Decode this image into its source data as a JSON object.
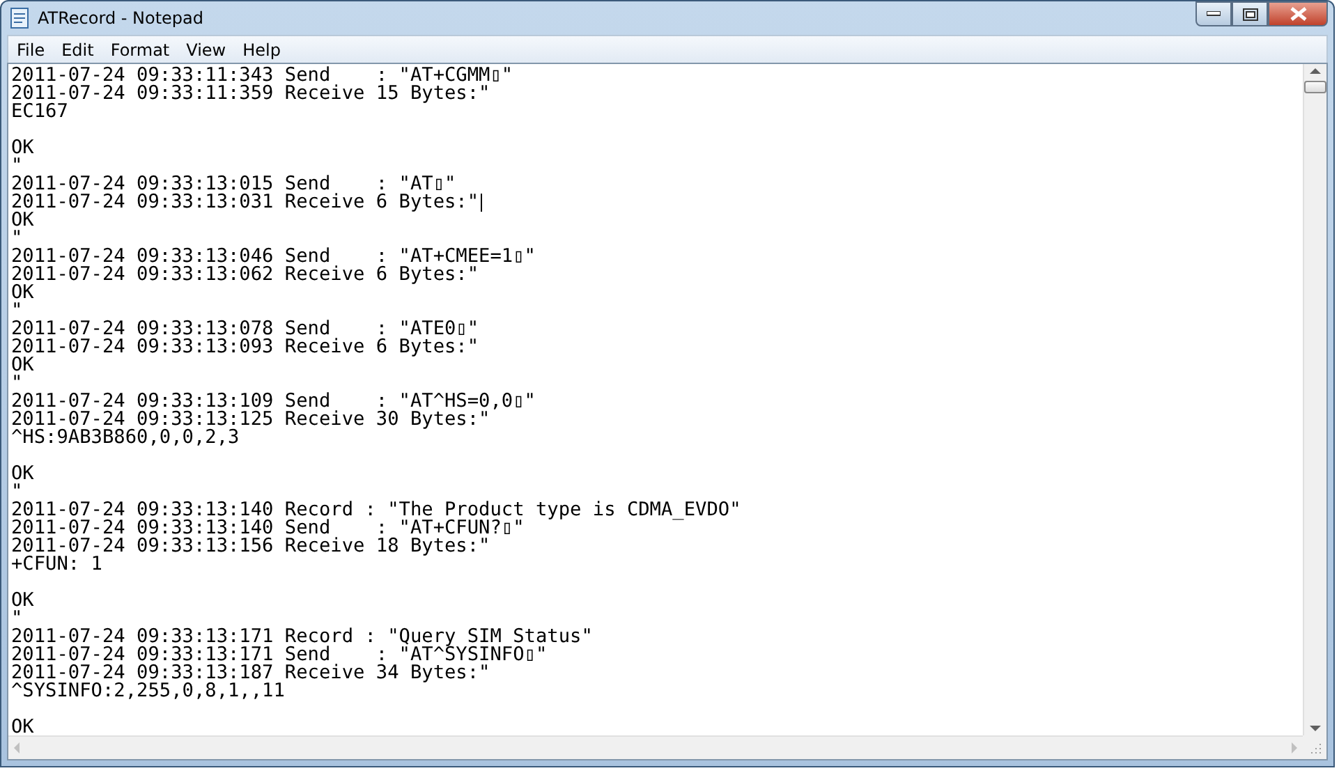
{
  "window": {
    "title": "ATRecord - Notepad"
  },
  "menu": [
    "File",
    "Edit",
    "Format",
    "View",
    "Help"
  ],
  "editor": {
    "paragraphs": [
      {
        "lines": [
          {
            "text": "2011-07-24 09:33:11:343 Send    : \"AT+CGMM▯\"",
            "caret": false
          },
          {
            "text": "2011-07-24 09:33:11:359 Receive 15 Bytes:\"",
            "caret": false
          },
          {
            "text": "EC167",
            "caret": false
          }
        ]
      },
      {
        "lines": [
          {
            "text": "OK",
            "caret": false
          },
          {
            "text": "\"",
            "caret": false
          },
          {
            "text": "2011-07-24 09:33:13:015 Send    : \"AT▯\"",
            "caret": false
          },
          {
            "text": "2011-07-24 09:33:13:031 Receive 6 Bytes:\"",
            "caret": true
          },
          {
            "text": "OK",
            "caret": false
          },
          {
            "text": "\"",
            "caret": false
          },
          {
            "text": "2011-07-24 09:33:13:046 Send    : \"AT+CMEE=1▯\"",
            "caret": false
          },
          {
            "text": "2011-07-24 09:33:13:062 Receive 6 Bytes:\"",
            "caret": false
          },
          {
            "text": "OK",
            "caret": false
          },
          {
            "text": "\"",
            "caret": false
          },
          {
            "text": "2011-07-24 09:33:13:078 Send    : \"ATE0▯\"",
            "caret": false
          },
          {
            "text": "2011-07-24 09:33:13:093 Receive 6 Bytes:\"",
            "caret": false
          },
          {
            "text": "OK",
            "caret": false
          },
          {
            "text": "\"",
            "caret": false
          },
          {
            "text": "2011-07-24 09:33:13:109 Send    : \"AT^HS=0,0▯\"",
            "caret": false
          },
          {
            "text": "2011-07-24 09:33:13:125 Receive 30 Bytes:\"",
            "caret": false
          },
          {
            "text": "^HS:9AB3B860,0,0,2,3",
            "caret": false
          }
        ]
      },
      {
        "lines": [
          {
            "text": "OK",
            "caret": false
          },
          {
            "text": "\"",
            "caret": false
          },
          {
            "text": "2011-07-24 09:33:13:140 Record : \"The Product type is CDMA_EVDO\"",
            "caret": false
          },
          {
            "text": "2011-07-24 09:33:13:140 Send    : \"AT+CFUN?▯\"",
            "caret": false
          },
          {
            "text": "2011-07-24 09:33:13:156 Receive 18 Bytes:\"",
            "caret": false
          },
          {
            "text": "+CFUN: 1",
            "caret": false
          }
        ]
      },
      {
        "lines": [
          {
            "text": "OK",
            "caret": false
          },
          {
            "text": "\"",
            "caret": false
          },
          {
            "text": "2011-07-24 09:33:13:171 Record : \"Query SIM Status\"",
            "caret": false
          },
          {
            "text": "2011-07-24 09:33:13:171 Send    : \"AT^SYSINFO▯\"",
            "caret": false
          },
          {
            "text": "2011-07-24 09:33:13:187 Receive 34 Bytes:\"",
            "caret": false
          },
          {
            "text": "^SYSINFO:2,255,0,8,1,,11",
            "caret": false
          }
        ]
      },
      {
        "lines": [
          {
            "text": "OK",
            "caret": false
          }
        ]
      }
    ]
  }
}
